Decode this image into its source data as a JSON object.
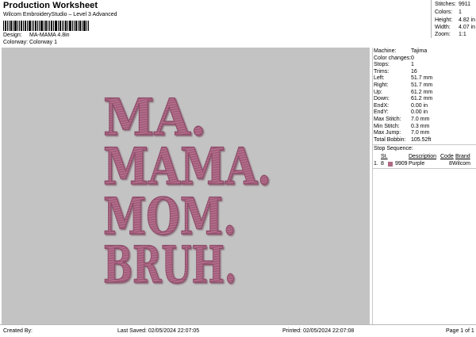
{
  "header": {
    "title": "Production Worksheet",
    "subtitle": "Wilcom EmbroideryStudio – Level 3 Advanced"
  },
  "meta": {
    "design_label": "Design:",
    "design_value": "MA-MAMA 4.8in",
    "colorway_label": "Colorway:",
    "colorway_value": "Colorway 1"
  },
  "stats": {
    "stitches_label": "Stitches:",
    "stitches": "9911",
    "colors_label": "Colors:",
    "colors": "1",
    "height_label": "Height:",
    "height": "4.82 in",
    "width_label": "Width:",
    "width": "4.07 in",
    "zoom_label": "Zoom:",
    "zoom": "1:1"
  },
  "design": {
    "lines": [
      "MA.",
      "MAMA.",
      "MOM.",
      "BRUH."
    ],
    "thread_color": "#b06a86",
    "background_color": "#c3c3c3"
  },
  "machine": {
    "rows": [
      {
        "label": "Machine:",
        "value": "Tajima"
      },
      {
        "label": "Color changes:",
        "value": "0"
      },
      {
        "label": "Stops:",
        "value": "1"
      },
      {
        "label": "Trims:",
        "value": "16"
      },
      {
        "label": "Left:",
        "value": "51.7 mm"
      },
      {
        "label": "Right:",
        "value": "51.7 mm"
      },
      {
        "label": "Up:",
        "value": "61.2 mm"
      },
      {
        "label": "Down:",
        "value": "61.2 mm"
      },
      {
        "label": "EndX:",
        "value": "0.00 in"
      },
      {
        "label": "EndY:",
        "value": "0.00 in"
      },
      {
        "label": "Max Stitch:",
        "value": "7.0 mm"
      },
      {
        "label": "Min Stitch:",
        "value": "0.3 mm"
      },
      {
        "label": "Max Jump:",
        "value": "7.0 mm"
      },
      {
        "label": "Total Bobbin:",
        "value": "105.52ft"
      }
    ]
  },
  "stop_sequence": {
    "title": "Stop Sequence:",
    "headers": {
      "st": "St.",
      "description": "Description",
      "code": "Code",
      "brand": "Brand"
    },
    "rows": [
      {
        "index": "1.",
        "st": "8",
        "swatch": "#b06a86",
        "number": "9909",
        "description": "Purple",
        "code": "8",
        "brand": "Wilcom"
      }
    ]
  },
  "footer": {
    "created_by": "Created By:",
    "last_saved": "Last Saved: 02/05/2024 22:07:05",
    "printed": "Printed: 02/05/2024 22:07:08",
    "page": "Page 1 of 1"
  }
}
